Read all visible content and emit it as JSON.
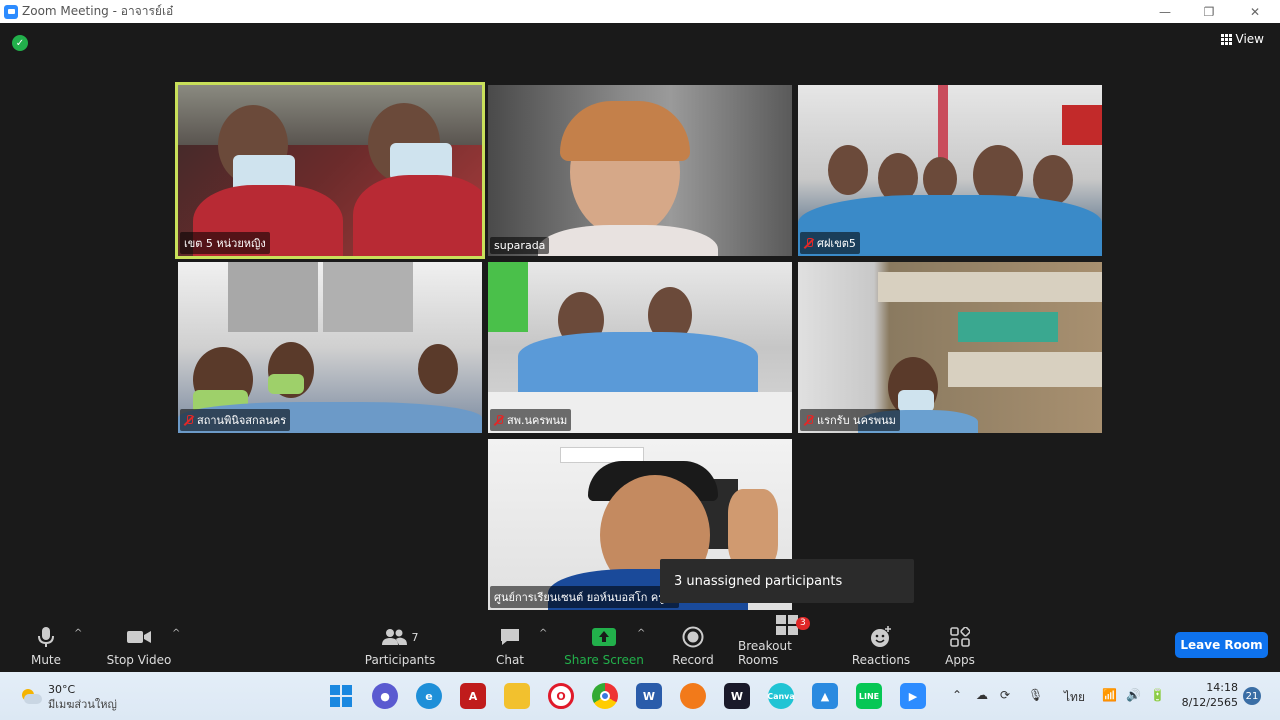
{
  "window": {
    "title": "Zoom Meeting - อาจารย์เอ๋",
    "controls": [
      "minimize",
      "maximize",
      "close"
    ]
  },
  "meeting": {
    "view_label": "View",
    "security_icon": "shield-check-icon",
    "participants": [
      {
        "name": "เขต 5 หน่วยหญิง",
        "muted": false,
        "active_speaker": true
      },
      {
        "name": "suparada",
        "muted": false,
        "active_speaker": false
      },
      {
        "name": "ศฝเขต5",
        "muted": true,
        "active_speaker": false
      },
      {
        "name": "สถานพินิจสกลนคร",
        "muted": true,
        "active_speaker": false
      },
      {
        "name": "สพ.นครพนม",
        "muted": true,
        "active_speaker": false
      },
      {
        "name": "แรกรับ นครพนม",
        "muted": true,
        "active_speaker": false
      },
      {
        "name": "ศูนย์การเรียนเซนต์ ยอห์นบอสโก ครู...",
        "muted": false,
        "active_speaker": false
      }
    ],
    "tooltip": "3 unassigned participants"
  },
  "toolbar": {
    "mute": "Mute",
    "stop_video": "Stop Video",
    "participants": "Participants",
    "participants_count": "7",
    "chat": "Chat",
    "share_screen": "Share Screen",
    "record": "Record",
    "breakout_rooms": "Breakout Rooms",
    "breakout_badge": "3",
    "reactions": "Reactions",
    "apps": "Apps",
    "leave_room": "Leave Room",
    "accent": "#0e72ed",
    "share_color": "#22b04b"
  },
  "taskbar": {
    "weather_temp": "30°C",
    "weather_desc": "มีเมฆส่วนใหญ่",
    "language": "ไทย",
    "time": "14:18",
    "date": "8/12/2565",
    "notifications": "21",
    "pinned": [
      "windows-start",
      "teams",
      "edge",
      "acrobat",
      "file-explorer",
      "opera",
      "chrome",
      "word",
      "firefox",
      "wps",
      "canva",
      "azure",
      "line",
      "zoom"
    ]
  }
}
